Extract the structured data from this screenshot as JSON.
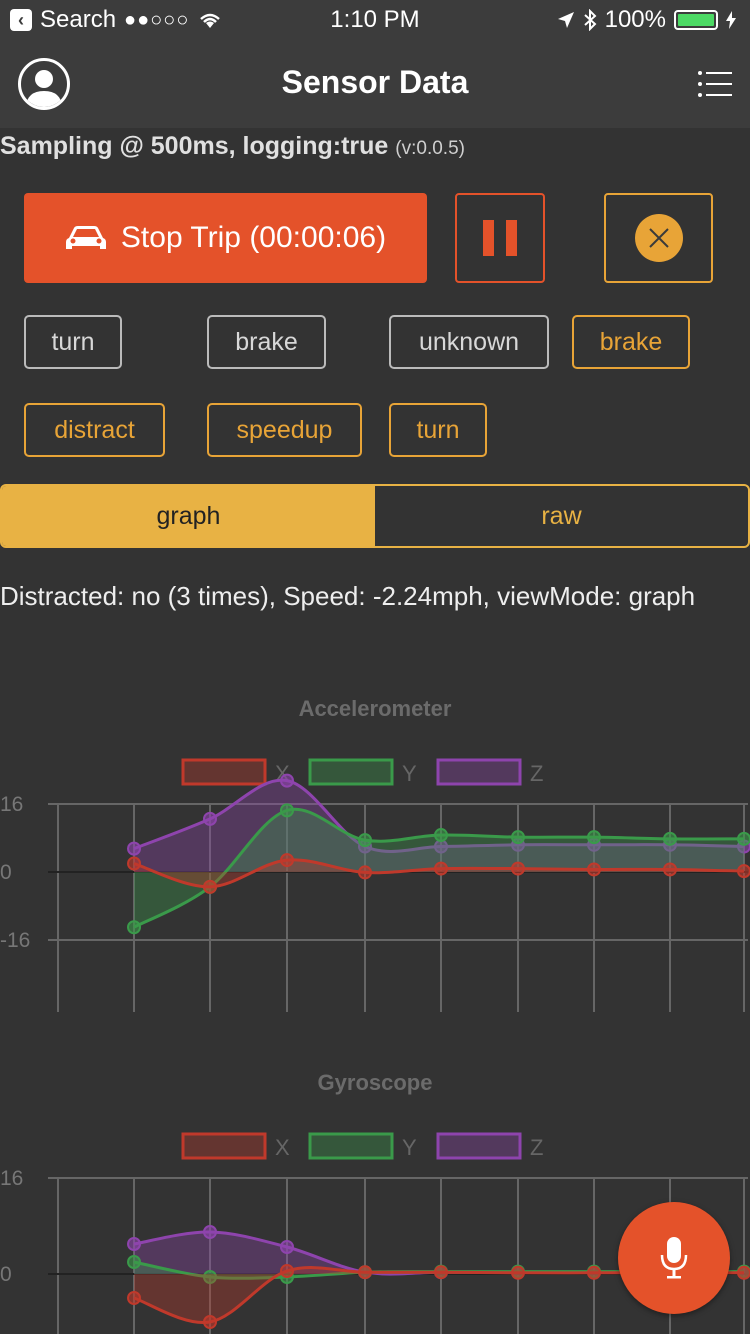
{
  "status_bar": {
    "back_label": "Search",
    "signal": "●●○○○",
    "time": "1:10 PM",
    "battery": "100%"
  },
  "nav": {
    "title": "Sensor Data"
  },
  "sampling": {
    "main": "Sampling @ 500ms, logging:true",
    "version": "(v:0.0.5)"
  },
  "controls": {
    "stop_trip_label": "Stop Trip (00:00:06)"
  },
  "tags": [
    "turn",
    "brake",
    "unknown",
    "brake",
    "distract",
    "speedup",
    "turn"
  ],
  "segment": {
    "graph_label": "graph",
    "raw_label": "raw"
  },
  "info_text": "Distracted: no (3 times), Speed: -2.24mph, viewMode: graph",
  "colors": {
    "accent_orange": "#e4522a",
    "accent_yellow": "#e8a437",
    "series_x": "#c0392b",
    "series_y": "#3a9a4a",
    "series_z": "#8e44ad"
  },
  "chart_data": [
    {
      "type": "area",
      "title": "Accelerometer",
      "ylim": [
        -16,
        16
      ],
      "yticks": [
        "16",
        "0",
        "-16"
      ],
      "x": [
        1,
        2,
        3,
        4,
        5,
        6,
        7,
        8,
        9
      ],
      "series": [
        {
          "name": "X",
          "color": "#c0392b",
          "values": [
            2,
            -3.5,
            2.8,
            -0.1,
            0.8,
            0.8,
            0.6,
            0.6,
            0.2
          ]
        },
        {
          "name": "Y",
          "color": "#3a9a4a",
          "values": [
            -13,
            -3.5,
            14.5,
            7.5,
            8.7,
            8.2,
            8.2,
            7.8,
            7.8
          ]
        },
        {
          "name": "Z",
          "color": "#8e44ad",
          "values": [
            5.5,
            12.5,
            21.5,
            6,
            6,
            6.4,
            6.4,
            6.4,
            6
          ]
        }
      ]
    },
    {
      "type": "area",
      "title": "Gyroscope",
      "ylim": [
        -16,
        16
      ],
      "yticks": [
        "16",
        "0"
      ],
      "x": [
        1,
        2,
        3,
        4,
        5,
        6,
        7,
        8,
        9
      ],
      "series": [
        {
          "name": "X",
          "color": "#c0392b",
          "values": [
            -4,
            -8,
            0.5,
            0.3,
            0.3,
            0.2,
            0.2,
            0.2,
            0.2
          ]
        },
        {
          "name": "Y",
          "color": "#3a9a4a",
          "values": [
            2,
            -0.5,
            -0.5,
            0.3,
            0.4,
            0.4,
            0.4,
            0.4,
            0.4
          ]
        },
        {
          "name": "Z",
          "color": "#8e44ad",
          "values": [
            5,
            7,
            4.5,
            0.3,
            0.3,
            0.3,
            0.3,
            0.3,
            0.3
          ]
        }
      ]
    }
  ]
}
